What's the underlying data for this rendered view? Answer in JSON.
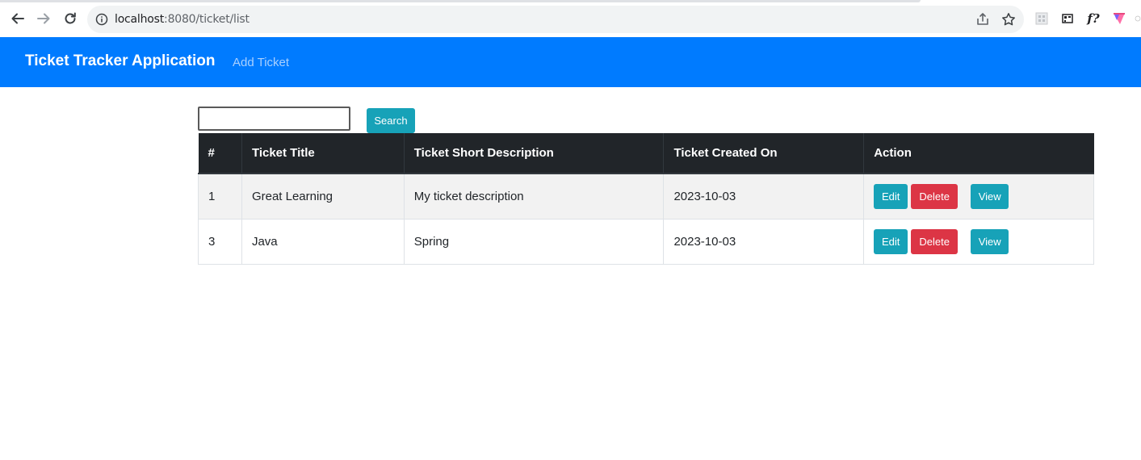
{
  "browser": {
    "url_host": "localhost",
    "url_rest": ":8080/ticket/list"
  },
  "navbar": {
    "brand": "Ticket Tracker Application",
    "add_ticket": "Add Ticket"
  },
  "search": {
    "value": "",
    "button_label": "Search"
  },
  "table": {
    "headers": [
      "#",
      "Ticket Title",
      "Ticket Short Description",
      "Ticket Created On",
      "Action"
    ],
    "rows": [
      {
        "id": "1",
        "title": "Great Learning",
        "description": "My ticket description",
        "created_on": "2023-10-03"
      },
      {
        "id": "3",
        "title": "Java",
        "description": "Spring",
        "created_on": "2023-10-03"
      }
    ],
    "actions": {
      "edit": "Edit",
      "delete": "Delete",
      "view": "View"
    }
  },
  "colors": {
    "navbar": "#007bff",
    "table_header": "#212529",
    "info_button": "#17a2b8",
    "danger_button": "#dc3545"
  }
}
